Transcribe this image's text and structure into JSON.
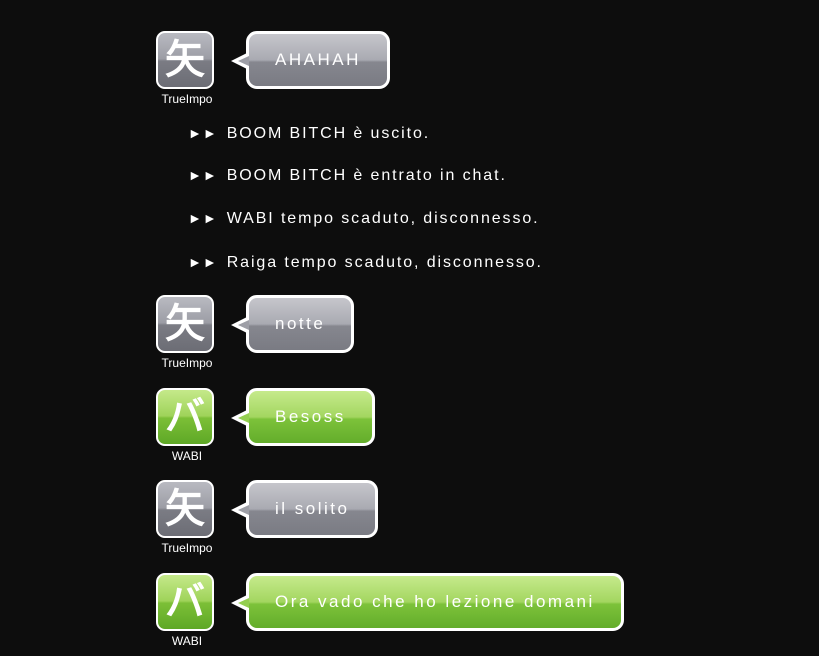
{
  "messages": [
    {
      "type": "chat",
      "user": "TrueImpo",
      "avatar_glyph": "矢",
      "color": "grey",
      "text": "AHAHAH"
    },
    {
      "type": "system",
      "arrow": "►►",
      "text": "BOOM BITCH è uscito."
    },
    {
      "type": "system",
      "arrow": "►►",
      "text": "BOOM BITCH è entrato in chat."
    },
    {
      "type": "system",
      "arrow": "►►",
      "text": "WABI tempo scaduto, disconnesso."
    },
    {
      "type": "system",
      "arrow": "►►",
      "text": "Raiga tempo scaduto, disconnesso."
    },
    {
      "type": "chat",
      "user": "TrueImpo",
      "avatar_glyph": "矢",
      "color": "grey",
      "text": "notte"
    },
    {
      "type": "chat",
      "user": "WABI",
      "avatar_glyph": "バ",
      "color": "green",
      "text": "Besoss"
    },
    {
      "type": "chat",
      "user": "TrueImpo",
      "avatar_glyph": "矢",
      "color": "grey",
      "text": "il solito"
    },
    {
      "type": "chat",
      "user": "WABI",
      "avatar_glyph": "バ",
      "color": "green",
      "text": "Ora vado che ho lezione domani"
    }
  ],
  "colors": {
    "background": "#0d0d0d",
    "grey_bubble": "#9d9ea6",
    "green_bubble": "#94cf50",
    "text": "#ffffff"
  }
}
